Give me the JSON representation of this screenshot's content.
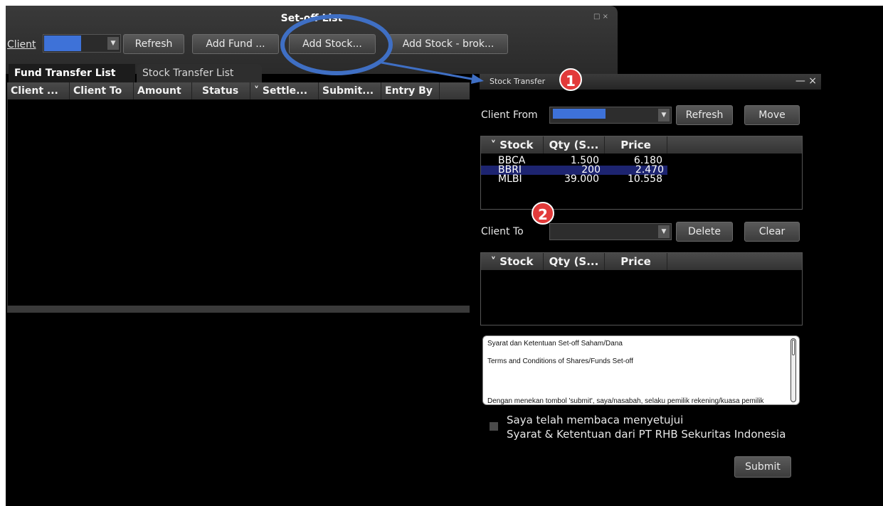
{
  "setoff": {
    "title": "Set-off List",
    "window_ctrl": "□ ×",
    "client_label": "Client",
    "refresh_label": "Refresh",
    "add_fund_label": "Add Fund ...",
    "add_stock_label": "Add Stock...",
    "add_stock_broker_label": "Add Stock - brok...",
    "tabs": [
      "Fund Transfer List",
      "Stock Transfer List"
    ],
    "columns": [
      "Client ...",
      "Client To",
      "Amount",
      "Status",
      "˅ Settle...",
      "Submit...",
      "Entry By"
    ]
  },
  "stock_transfer": {
    "title": "Stock Transfer",
    "window_ctrl": "— ×",
    "client_from_label": "Client From",
    "refresh_label": "Refresh",
    "move_label": "Move",
    "columns": [
      "˅ Stock",
      "Qty (S...",
      "Price"
    ],
    "rows": [
      {
        "stock": "BBCA",
        "qty": "1.500",
        "price": "6.180"
      },
      {
        "stock": "BBRI",
        "qty": "200",
        "price": "2.470"
      },
      {
        "stock": "MLBI",
        "qty": "39.000",
        "price": "10.558"
      }
    ],
    "client_to_label": "Client To",
    "delete_label": "Delete",
    "clear_label": "Clear",
    "terms_lines": [
      "Syarat dan Ketentuan Set-off Saham/Dana",
      "Terms and Conditions of Shares/Funds Set-off",
      "Dengan menekan tombol 'submit', saya/nasabah, selaku pemilik rekening/kuasa pemilik"
    ],
    "agree_line1": "Saya telah membaca menyetujui",
    "agree_line2": "Syarat & Ketentuan dari PT RHB Sekuritas Indonesia",
    "submit_label": "Submit"
  },
  "annotations": {
    "badge1": "1",
    "badge2": "2",
    "highlight_color": "#3f6fc4",
    "badge_color": "#e23a3a"
  }
}
